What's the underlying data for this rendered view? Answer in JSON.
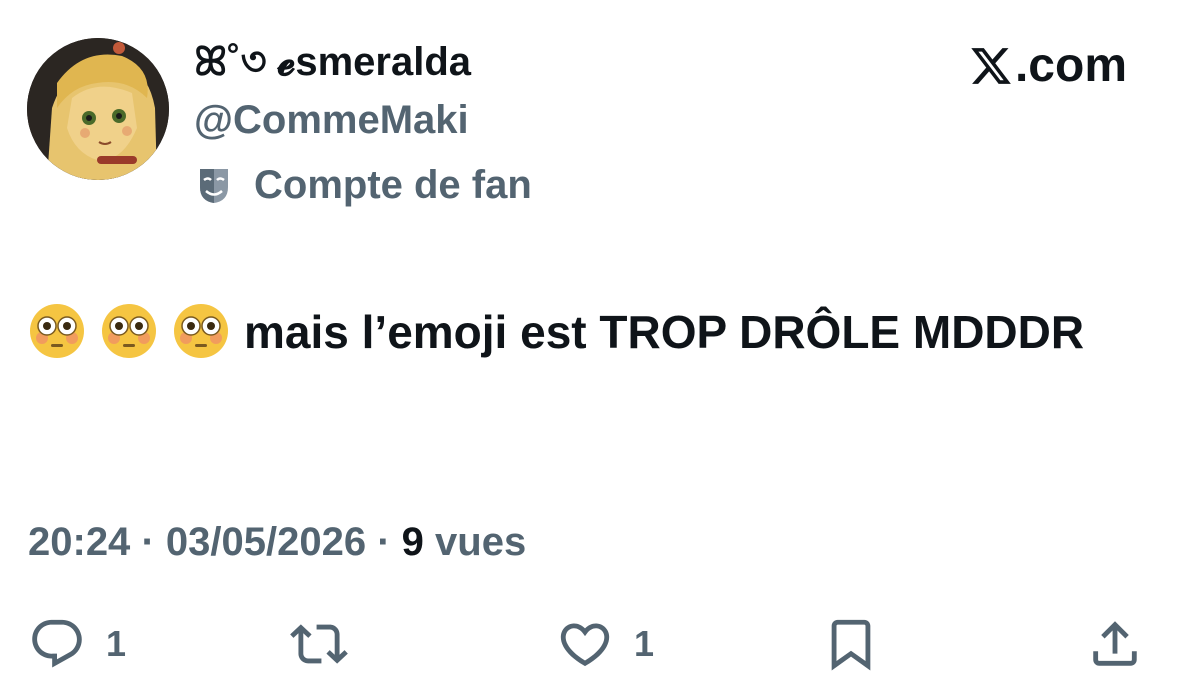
{
  "author": {
    "display_name": "ꕤ˚৩ 𝓮smeralda",
    "handle": "@CommeMaki",
    "label": "Compte de fan",
    "label_icon": "theater-mask-icon",
    "avatar": "avatar-illustration"
  },
  "brand": {
    "suffix": ".com",
    "logo_icon": "x-logo-icon"
  },
  "tweet": {
    "text": "mais l’emoji est TROP DRÔLE MDDDR",
    "emojis": [
      "flushed-face-emoji",
      "flushed-face-emoji",
      "flushed-face-emoji"
    ]
  },
  "meta": {
    "time": "20:24",
    "separator": "·",
    "date": "03/05/2026",
    "views_count": "9",
    "views_label": "vues"
  },
  "actions": {
    "replies": "1",
    "reposts": "",
    "likes": "1"
  },
  "colors": {
    "text": "#0f1419",
    "muted": "#536471",
    "background": "#ffffff"
  }
}
